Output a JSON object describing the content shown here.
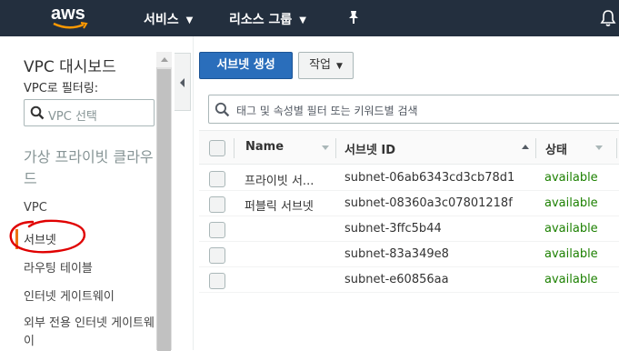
{
  "header": {
    "logo_text": "aws",
    "nav_services": "서비스",
    "nav_resource_groups": "리소스 그룹",
    "pin_icon": "pin-icon",
    "bell_icon": "bell-icon",
    "background": "#232f3e"
  },
  "sidebar": {
    "title": "VPC 대시보드",
    "filter_label": "VPC로 필터링:",
    "filter_placeholder": "VPC 선택",
    "section_title": "가상 프라이빗 클라우드",
    "items": [
      {
        "label": "VPC"
      },
      {
        "label": "서브넷",
        "active": true
      },
      {
        "label": "라우팅 테이블"
      },
      {
        "label": "인터넷 게이트웨이"
      },
      {
        "label": "외부 전용 인터넷 게이트웨이"
      }
    ]
  },
  "toolbar": {
    "create_subnet": "서브넷 생성",
    "actions": "작업"
  },
  "search": {
    "placeholder": "태그 및 속성별 필터 또는 키워드별 검색"
  },
  "table": {
    "columns": [
      "Name",
      "서브넷 ID",
      "상태"
    ],
    "rows": [
      {
        "name": "프라이빗 서...",
        "id": "subnet-06ab6343cd3cb78d1",
        "status": "available"
      },
      {
        "name": "퍼블릭 서브넷",
        "id": "subnet-08360a3c07801218f",
        "status": "available"
      },
      {
        "name": "",
        "id": "subnet-3ffc5b44",
        "status": "available"
      },
      {
        "name": "",
        "id": "subnet-83a349e8",
        "status": "available"
      },
      {
        "name": "",
        "id": "subnet-e60856aa",
        "status": "available"
      }
    ]
  },
  "colors": {
    "primary_button": "#2a6ebb",
    "status_available": "#1d8102",
    "active_indicator": "#ec7211",
    "annotation_circle": "#e00000"
  }
}
